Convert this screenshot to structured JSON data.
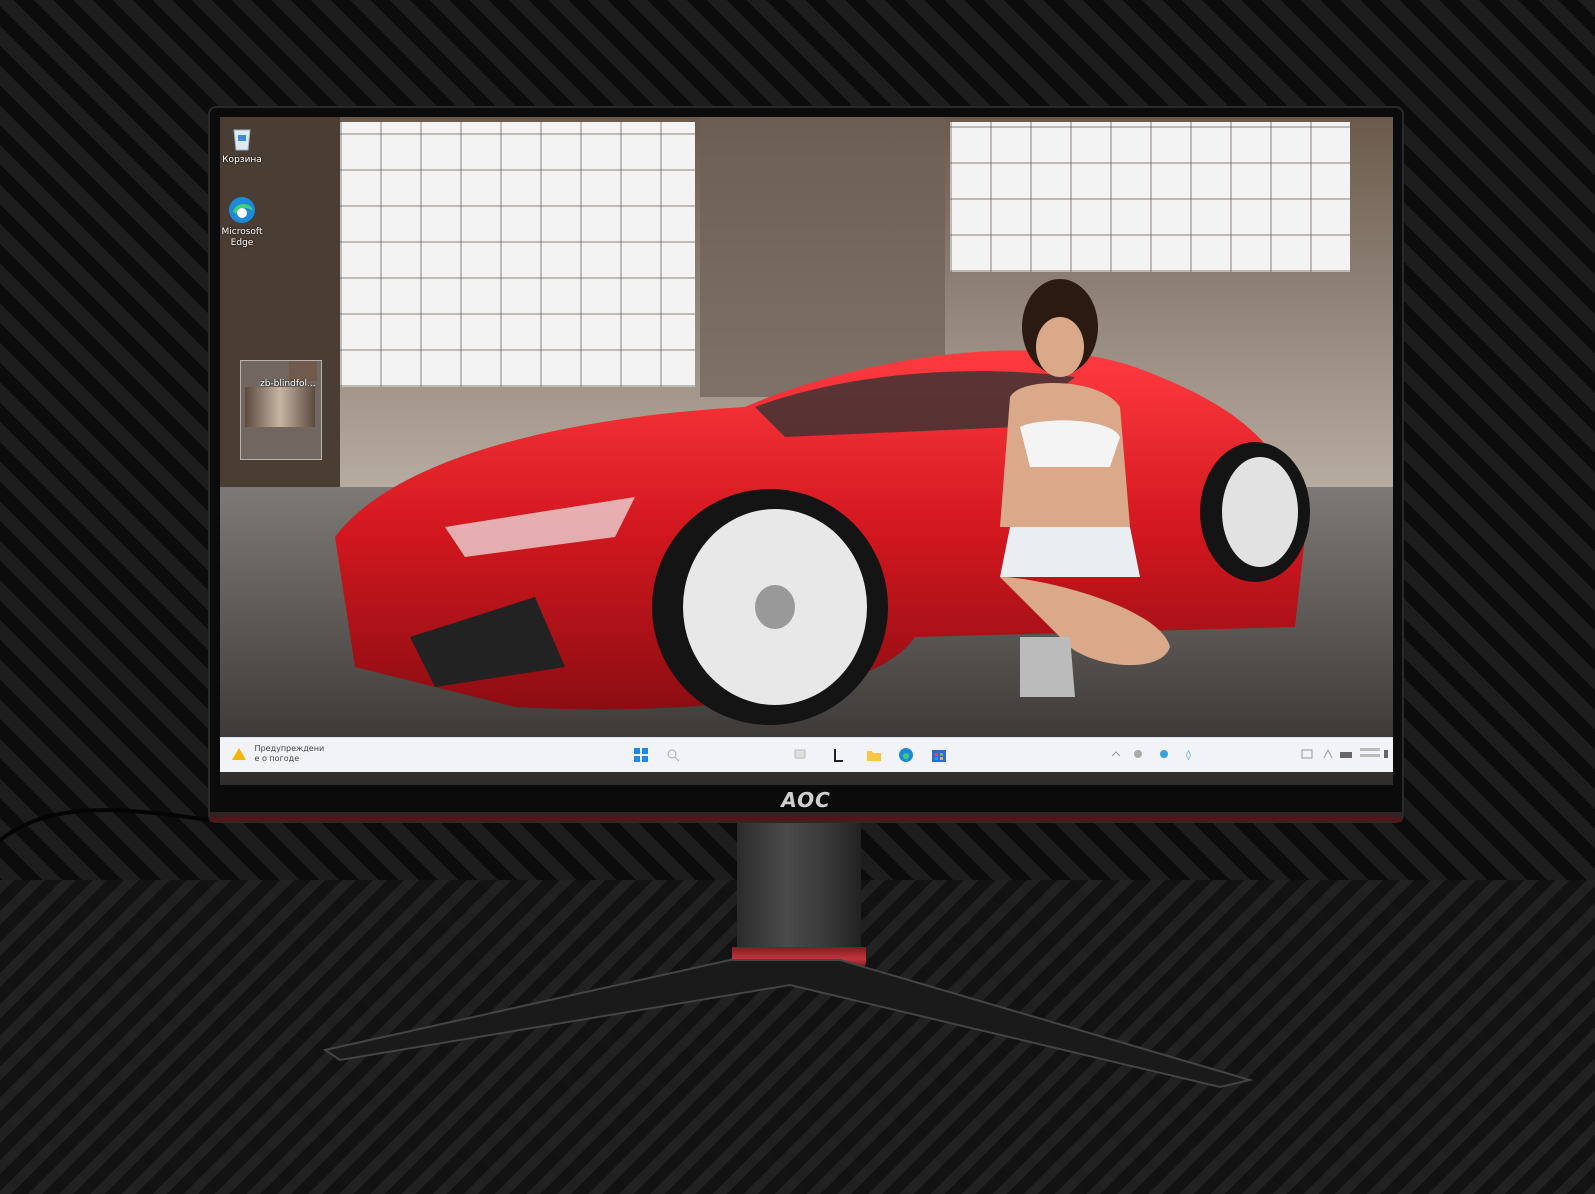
{
  "scene": {
    "monitor_brand": "AOC",
    "desktop_icons": [
      {
        "label": "Корзина",
        "icon": "recycle-bin-icon"
      },
      {
        "label": "Microsoft Edge",
        "icon": "edge-icon"
      }
    ],
    "desktop_folder_label": "zb-blindfol...",
    "taskbar": {
      "weather_text_line1": "Предупреждени",
      "weather_text_line2": "е о погоде",
      "apps": [
        "start-icon",
        "search-icon",
        "task-view-icon",
        "widgets-icon",
        "folder-icon",
        "edge-icon",
        "store-icon"
      ]
    },
    "colors": {
      "car_red": "#d3171f",
      "wall_dark": "#111111",
      "stand_red": "#c4353b"
    }
  }
}
